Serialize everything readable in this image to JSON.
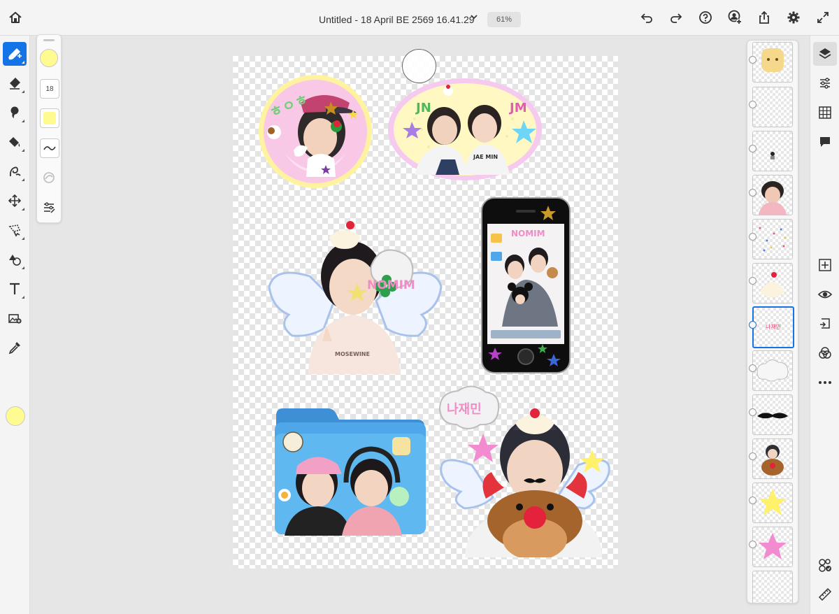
{
  "header": {
    "document_title": "Untitled - 18 April BE 2569 16.41.29",
    "zoom_label": "61%",
    "icons": [
      "home-icon",
      "chevron-down-icon",
      "undo-icon",
      "redo-icon",
      "help-icon",
      "invite-icon",
      "share-icon",
      "settings-icon",
      "fullscreen-icon"
    ]
  },
  "left_toolbar": {
    "tools": [
      "paint-brush",
      "eraser",
      "smudge",
      "fill",
      "liquify",
      "transform",
      "lasso-select",
      "shapes",
      "text",
      "place-image",
      "eyedropper"
    ],
    "active_tool": "paint-brush",
    "current_color": "#fffb91"
  },
  "brush_panel": {
    "brush_color": "#fffb91",
    "size_value": "18",
    "flow_color": "#fffb91"
  },
  "canvas": {
    "stickers": {
      "circle_text": "ㅎㅇㅎ",
      "oval_left": "JN",
      "oval_right": "JM",
      "oval_shirt": "JAE MIN",
      "bubble_text": "NOMIM",
      "phone_banner": "NOMIM",
      "shirt_text": "MOSEWINE",
      "cloud_text": "나재민"
    },
    "accent_colors": {
      "pink": "#f8c8e6",
      "yellow_ring": "#fff3a0",
      "folder_blue": "#4fa6e8",
      "star_pink": "#f28bd0",
      "star_yellow": "#fff26a"
    }
  },
  "layers_panel": {
    "selected_layer_text": "나재민",
    "layer_count": 13
  },
  "right_toolbar": {
    "icons": [
      "layers-icon",
      "adjustments-icon",
      "grid-icon",
      "comment-icon",
      "add-layer-icon",
      "visibility-icon",
      "merge-down-icon",
      "blend-icon",
      "more-icon",
      "layer-properties-icon",
      "ruler-icon"
    ]
  }
}
